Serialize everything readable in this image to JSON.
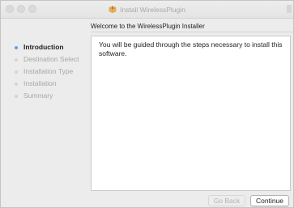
{
  "window": {
    "title": "Install WirelessPlugin",
    "title_icon": "package-icon"
  },
  "header": {
    "text": "Welcome to the WirelessPlugin Installer"
  },
  "sidebar": {
    "steps": [
      {
        "label": "Introduction",
        "active": true
      },
      {
        "label": "Destination Select",
        "active": false
      },
      {
        "label": "Installation Type",
        "active": false
      },
      {
        "label": "Installation",
        "active": false
      },
      {
        "label": "Summary",
        "active": false
      }
    ]
  },
  "content": {
    "body": "You will be guided through the steps necessary to install this software."
  },
  "buttons": {
    "back": "Go Back",
    "continue": "Continue"
  },
  "colors": {
    "active_dot": "#5aa3e6",
    "inactive_text": "#a7a7a7",
    "window_bg": "#ececec"
  }
}
